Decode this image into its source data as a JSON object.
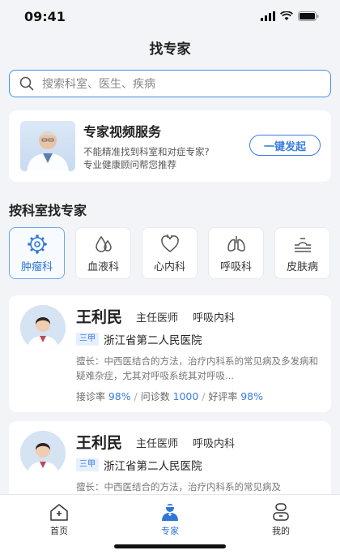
{
  "status_bar": {
    "time": "09:41"
  },
  "header": {
    "title": "找专家"
  },
  "search": {
    "placeholder": "搜索科室、医生、疾病"
  },
  "promo": {
    "title": "专家视频服务",
    "line1": "不能精准找到科室和对症专家?",
    "line2": "专业健康顾问帮您推荐",
    "button": "一键发起"
  },
  "section": {
    "title": "按科室找专家"
  },
  "departments": [
    {
      "label": "肿瘤科",
      "icon": "oncology-icon",
      "active": true
    },
    {
      "label": "血液科",
      "icon": "blood-drop-icon",
      "active": false
    },
    {
      "label": "心内科",
      "icon": "heart-icon",
      "active": false
    },
    {
      "label": "呼吸科",
      "icon": "lungs-icon",
      "active": false
    },
    {
      "label": "皮肤病",
      "icon": "skin-icon",
      "active": false
    }
  ],
  "doctors": [
    {
      "name": "王利民",
      "title": "主任医师",
      "dept": "呼吸内科",
      "badge": "三甲",
      "hospital": "浙江省第二人民医院",
      "desc": "擅长：中西医结合的方法，治疗内科系的常见病及多发病和疑难杂症，尤其对呼吸系统其对呼吸...",
      "consult_label": "接诊率",
      "consult_rate": "98%",
      "count_label": "问诊数",
      "count": "1000",
      "rating_label": "好评率",
      "rating": "98%"
    },
    {
      "name": "王利民",
      "title": "主任医师",
      "dept": "呼吸内科",
      "badge": "三甲",
      "hospital": "浙江省第二人民医院",
      "desc": "擅长：中西医结合的方法，治疗内科系的常见病及"
    }
  ],
  "tabbar": {
    "home": "首页",
    "experts": "专家",
    "mine": "我的",
    "active_color": "#2f77d6"
  },
  "colors": {
    "accent": "#3b7de0",
    "background": "#f2f4f7"
  }
}
